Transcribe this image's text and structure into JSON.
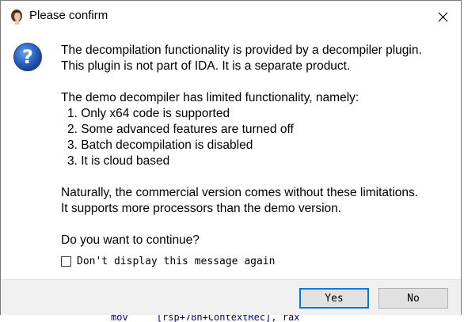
{
  "window": {
    "title": "Please confirm"
  },
  "message": {
    "para1": [
      "The decompilation functionality is provided by a decompiler plugin.",
      "This plugin is not part of IDA. It is a separate product."
    ],
    "para2_intro": "The demo decompiler has limited functionality, namely:",
    "limitations": [
      "1. Only x64 code is supported",
      "2. Some advanced features are turned off",
      "3. Batch decompilation is disabled",
      "3. It is cloud based"
    ],
    "para3": [
      "Naturally, the commercial version comes without these limitations.",
      "It supports more processors than the demo version."
    ],
    "question": "Do you want to continue?"
  },
  "checkbox": {
    "label": "Don't display this message again",
    "checked": false
  },
  "buttons": {
    "yes": "Yes",
    "no": "No"
  },
  "background": {
    "code_fragment": "mov     [rsp+78h+ContextRec], rax"
  },
  "colors": {
    "accent": "#0078d7",
    "footer_bg": "#f0f0f0",
    "icon_blue": "#1f5fbf"
  }
}
